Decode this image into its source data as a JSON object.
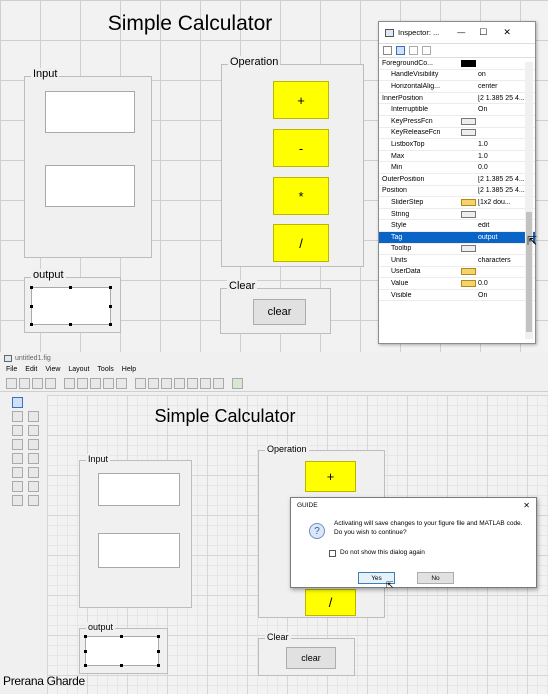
{
  "top_canvas": {
    "title": "Simple Calculator",
    "input_panel": {
      "label": "Input"
    },
    "output_panel": {
      "label": "output"
    },
    "operation_panel": {
      "label": "Operation"
    },
    "clear_panel": {
      "label": "Clear"
    },
    "buttons": {
      "plus": "+",
      "minus": "-",
      "multiply": "*",
      "divide": "/",
      "clear": "clear"
    }
  },
  "inspector": {
    "title": "Inspector: ...",
    "window_controls": {
      "minimize": "—",
      "maximize": "☐",
      "close": "✕"
    },
    "properties": [
      {
        "name": "ForegroundCo...",
        "value": ""
      },
      {
        "name": "HandleVisibility",
        "value": "on"
      },
      {
        "name": "HorizontalAlig...",
        "value": "center"
      },
      {
        "name": "InnerPosition",
        "value": "[2 1.385 25 4..."
      },
      {
        "name": "Interruptible",
        "value": "On"
      },
      {
        "name": "KeyPressFcn",
        "value": ""
      },
      {
        "name": "KeyReleaseFcn",
        "value": ""
      },
      {
        "name": "ListboxTop",
        "value": "1.0"
      },
      {
        "name": "Max",
        "value": "1.0"
      },
      {
        "name": "Min",
        "value": "0.0"
      },
      {
        "name": "OuterPosition",
        "value": "[2 1.385 25 4..."
      },
      {
        "name": "Position",
        "value": "[2 1.385 25 4..."
      },
      {
        "name": "SliderStep",
        "value": "[1x2 dou..."
      },
      {
        "name": "String",
        "value": ""
      },
      {
        "name": "Style",
        "value": "edit"
      },
      {
        "name": "Tag",
        "value": "output"
      },
      {
        "name": "Tooltip",
        "value": ""
      },
      {
        "name": "Units",
        "value": "characters"
      },
      {
        "name": "UserData",
        "value": ""
      },
      {
        "name": "Value",
        "value": "0.0"
      },
      {
        "name": "Visible",
        "value": "On"
      }
    ]
  },
  "guide_window": {
    "title": "untitled1.fig",
    "menu": [
      "File",
      "Edit",
      "View",
      "Layout",
      "Tools",
      "Help"
    ],
    "canvas": {
      "title": "Simple Calculator",
      "input_label": "Input",
      "operation_label": "Operation",
      "output_label": "output",
      "clear_label": "Clear",
      "plus": "+",
      "divide": "/",
      "clear": "clear"
    }
  },
  "dialog": {
    "title": "GUIDE",
    "message_line1": "Activating will save changes to your figure file and MATLAB code.",
    "message_line2": "Do you wish to continue?",
    "checkbox_label": "Do not show this dialog again",
    "yes": "Yes",
    "no": "No",
    "close": "✕"
  },
  "watermark": "Prerana Gharde"
}
